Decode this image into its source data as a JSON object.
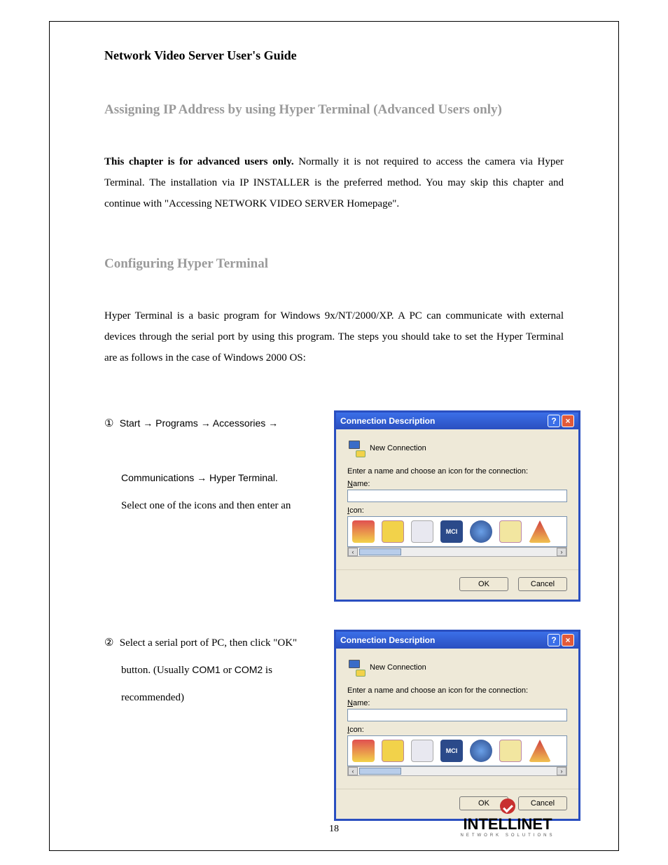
{
  "doc_title": "Network Video Server User's Guide",
  "section_heading": "Assigning IP Address by using Hyper Terminal (Advanced Users only)",
  "intro_bold": "This chapter is for advanced users only.",
  "intro_rest": " Normally it is not required to access the camera via Hyper Terminal. The installation via IP INSTALLER is the preferred method. You may skip this chapter and continue with \"Accessing NETWORK VIDEO SERVER Homepage\".",
  "sub_heading": "Configuring Hyper Terminal",
  "para2": "Hyper Terminal is a basic program for Windows 9x/NT/2000/XP. A PC can communicate with external devices through the serial port by using this program. The steps you should take to set the Hyper Terminal are as follows in the case of Windows 2000 OS:",
  "step1": {
    "num": "①",
    "line1a": "Start ",
    "line1b": " Programs ",
    "line1c": " Accessories ",
    "line2a": "Communications ",
    "line2b": " Hyper Terminal.",
    "line3": "Select one of the icons and then enter an"
  },
  "step2": {
    "num": "②",
    "line1": "Select a serial port of PC, then click   \"OK\"",
    "line2a": "button.  (Usually  ",
    "line2b": "COM1",
    "line2c": " or  ",
    "line2d": "COM2",
    "line2e": " is",
    "line3": "recommended)"
  },
  "dialog": {
    "title": "Connection Description",
    "new_conn": "New Connection",
    "prompt": "Enter a name and choose an icon for the connection:",
    "name_label": "Name:",
    "icon_label": "Icon:",
    "mci": "MCI",
    "ok": "OK",
    "cancel": "Cancel"
  },
  "arrow": "→",
  "page_num": "18",
  "logo": {
    "text": "INTELLINET",
    "sub": "NETWORK SOLUTIONS"
  }
}
